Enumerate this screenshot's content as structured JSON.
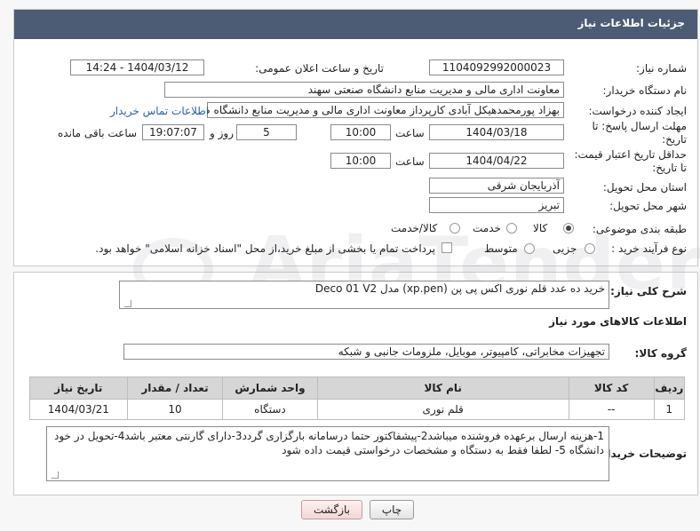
{
  "header": {
    "title": "جزئیات اطلاعات نیاز"
  },
  "fields": {
    "need_number": {
      "label": "شماره نیاز:",
      "value": "1104092992000023"
    },
    "announce_datetime": {
      "label": "تاریخ و ساعت اعلان عمومی:",
      "value": "1404/03/12 - 14:24"
    },
    "buyer_org": {
      "label": "نام دستگاه خریدار:",
      "value": "معاونت اداری  مالی و مدیریت منابع دانشگاه صنعتی سهند"
    },
    "requester": {
      "label": "ایجاد کننده درخواست:",
      "value": "بهزاد پورمحمدهیکل آبادی کارپرداز معاونت اداری  مالی و مدیریت منابع دانشگاه صنعتی سهند",
      "contact_link": "اطلاعات تماس خریدار"
    },
    "reply_deadline": {
      "label": "مهلت ارسال پاسخ: تا تاریخ:",
      "date": "1404/03/18",
      "time_label": "ساعت",
      "time": "10:00",
      "days": "5",
      "days_label": "روز و",
      "remaining": "19:07:07",
      "remaining_label": "ساعت باقی مانده"
    },
    "price_validity": {
      "label": "حداقل تاریخ اعتبار قیمت: تا تاریخ:",
      "date": "1404/04/22",
      "time_label": "ساعت",
      "time": "10:00"
    },
    "delivery_province": {
      "label": "استان محل تحویل:",
      "value": "آذربایجان شرقی"
    },
    "delivery_city": {
      "label": "شهر محل تحویل:",
      "value": "تبریز"
    },
    "category": {
      "label": "طبقه بندی موضوعی:",
      "options": [
        "کالا",
        "خدمت",
        "کالا/خدمت"
      ],
      "selected": "کالا"
    },
    "purchase_type": {
      "label": "نوع فرآیند خرید :",
      "options": [
        "جزیی",
        "متوسط"
      ],
      "note": "پرداخت تمام یا بخشی از مبلغ خرید،از محل \"اسناد خزانه اسلامی\" خواهد بود."
    }
  },
  "summary": {
    "label": "شرح کلی نیاز:",
    "value": "خرید ده عدد قلم نوری اکس پی پن (xp.pen) مدل  Deco 01 V2"
  },
  "goods_info": {
    "title": "اطلاعات کالاهای مورد نیاز",
    "group_label": "گروه کالا:",
    "group_value": "تجهیزات مخابراتی، کامپیوتر، موبایل، ملزومات جانبی و شبکه"
  },
  "table": {
    "headers": [
      "ردیف",
      "کد کالا",
      "نام کالا",
      "واحد شمارش",
      "تعداد / مقدار",
      "تاریخ نیاز"
    ],
    "rows": [
      [
        "1",
        "--",
        "قلم نوری",
        "دستگاه",
        "10",
        "1404/03/21"
      ]
    ]
  },
  "buyer_notes": {
    "label": "توضیحات خریدار:",
    "value": "1-هزینه ارسال برعهده فروشنده میباشد2-پیشفاکتور حتما درسامانه بارگزاری گردد3-دارای گارنتی معتبر باشد4-تحویل در خود دانشگاه 5- لطفا فقط به دستگاه و مشخصات درخواستی قیمت داده شود"
  },
  "buttons": {
    "print": "چاپ",
    "back": "بازگشت"
  },
  "watermark": "AriaTender.neT"
}
